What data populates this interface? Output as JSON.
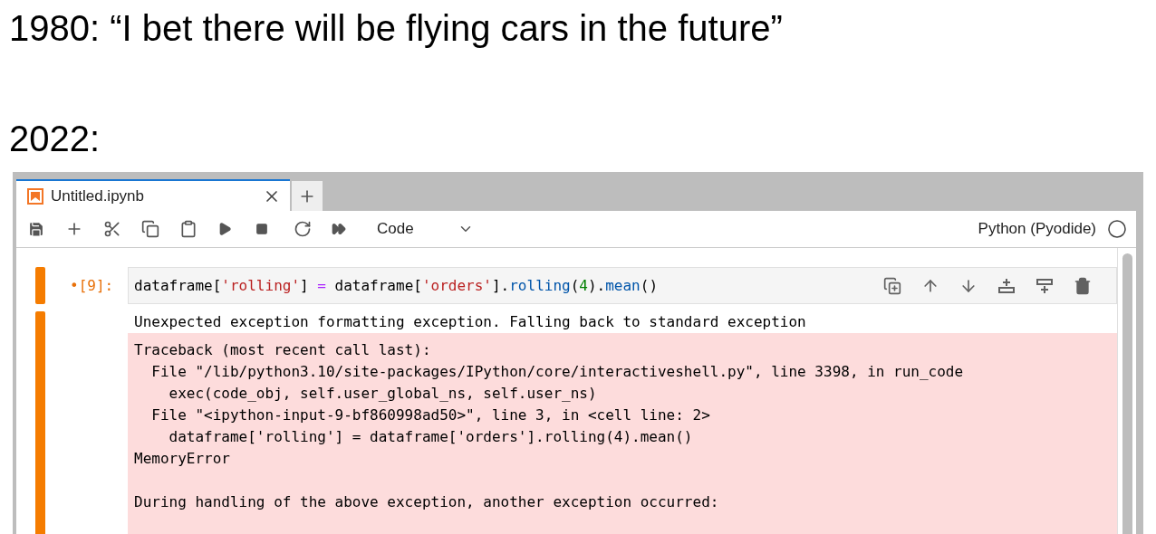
{
  "captions": [
    "1980: “I bet there will be flying cars in the future”",
    "2022:"
  ],
  "tabs": [
    {
      "label": "Untitled.ipynb",
      "selected": true
    }
  ],
  "toolbar": {
    "cell_type": "Code",
    "kernel": "Python (Pyodide)"
  },
  "cell": {
    "prompt": "•[9]:",
    "code": [
      {
        "text": "dataframe[",
        "kind": "plain"
      },
      {
        "text": "'rolling'",
        "kind": "string"
      },
      {
        "text": "] ",
        "kind": "plain"
      },
      {
        "text": "=",
        "kind": "operator"
      },
      {
        "text": " dataframe[",
        "kind": "plain"
      },
      {
        "text": "'orders'",
        "kind": "string"
      },
      {
        "text": "].",
        "kind": "plain"
      },
      {
        "text": "rolling",
        "kind": "name"
      },
      {
        "text": "(",
        "kind": "plain"
      },
      {
        "text": "4",
        "kind": "number"
      },
      {
        "text": ").",
        "kind": "plain"
      },
      {
        "text": "mean",
        "kind": "name"
      },
      {
        "text": "()",
        "kind": "plain"
      }
    ],
    "stdout": "Unexpected exception formatting exception. Falling back to standard exception",
    "traceback": [
      "Traceback (most recent call last):",
      "  File \"/lib/python3.10/site-packages/IPython/core/interactiveshell.py\", line 3398, in run_code",
      "    exec(code_obj, self.user_global_ns, self.user_ns)",
      "  File \"<ipython-input-9-bf860998ad50>\", line 3, in <cell line: 2>",
      "    dataframe['rolling'] = dataframe['orders'].rolling(4).mean()",
      "MemoryError"
    ],
    "followup": "During handling of the above exception, another exception occurred:"
  }
}
